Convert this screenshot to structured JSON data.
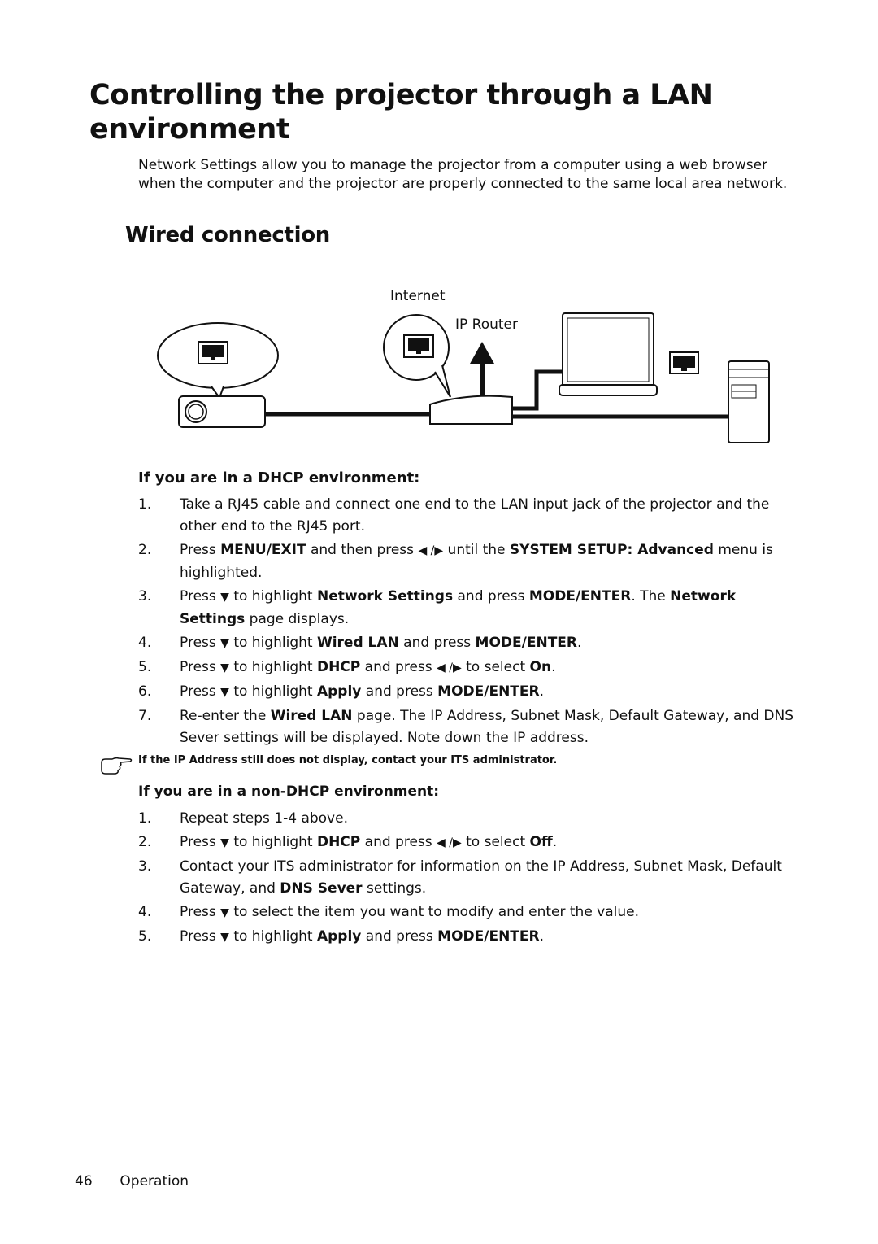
{
  "page": {
    "title": "Controlling the projector through a LAN environment",
    "intro": "Network Settings allow you to manage the projector from a computer using a web browser when the computer and the projector are properly connected to the same local area network.",
    "section_heading": "Wired connection"
  },
  "diagram": {
    "label_internet": "Internet",
    "label_router": "IP Router",
    "components": [
      "projector",
      "ip-router",
      "laptop",
      "desktop-pc",
      "rj45-port-projector",
      "rj45-port-router",
      "rj45-port-computer"
    ]
  },
  "dhcp": {
    "heading": "If you are in a DHCP environment:",
    "steps": [
      {
        "num": "1.",
        "parts": [
          [
            "t",
            "Take a RJ45 cable and connect one end to the LAN input jack of the projector and the other end to the RJ45 port."
          ]
        ]
      },
      {
        "num": "2.",
        "parts": [
          [
            "t",
            "Press "
          ],
          [
            "b",
            "MENU/EXIT"
          ],
          [
            "t",
            " and then press "
          ],
          [
            "a",
            "◀ /▶"
          ],
          [
            "t",
            " until the "
          ],
          [
            "b",
            "SYSTEM SETUP: Advanced"
          ],
          [
            "t",
            " menu is highlighted."
          ]
        ]
      },
      {
        "num": "3.",
        "parts": [
          [
            "t",
            "Press "
          ],
          [
            "a",
            "▼"
          ],
          [
            "t",
            " to highlight "
          ],
          [
            "b",
            "Network Settings"
          ],
          [
            "t",
            " and press "
          ],
          [
            "b",
            "MODE/ENTER"
          ],
          [
            "t",
            ". The "
          ],
          [
            "b",
            "Network Settings"
          ],
          [
            "t",
            " page displays."
          ]
        ]
      },
      {
        "num": "4.",
        "parts": [
          [
            "t",
            "Press "
          ],
          [
            "a",
            "▼"
          ],
          [
            "t",
            " to highlight "
          ],
          [
            "b",
            "Wired LAN"
          ],
          [
            "t",
            " and press "
          ],
          [
            "b",
            "MODE/ENTER"
          ],
          [
            "t",
            "."
          ]
        ]
      },
      {
        "num": "5.",
        "parts": [
          [
            "t",
            "Press "
          ],
          [
            "a",
            "▼"
          ],
          [
            "t",
            " to highlight "
          ],
          [
            "b",
            "DHCP"
          ],
          [
            "t",
            " and press "
          ],
          [
            "a",
            "◀ /▶"
          ],
          [
            "t",
            " to select "
          ],
          [
            "b",
            "On"
          ],
          [
            "t",
            "."
          ]
        ]
      },
      {
        "num": "6.",
        "parts": [
          [
            "t",
            "Press "
          ],
          [
            "a",
            "▼"
          ],
          [
            "t",
            " to highlight "
          ],
          [
            "b",
            "Apply"
          ],
          [
            "t",
            " and press "
          ],
          [
            "b",
            "MODE/ENTER"
          ],
          [
            "t",
            "."
          ]
        ]
      },
      {
        "num": "7.",
        "parts": [
          [
            "t",
            "Re-enter the "
          ],
          [
            "b",
            "Wired LAN"
          ],
          [
            "t",
            " page. The IP Address, Subnet Mask, Default Gateway, and DNS Sever settings will be displayed. Note down the IP address."
          ]
        ]
      }
    ]
  },
  "note": {
    "icon": "pointing-hand-icon",
    "text": "If the IP Address still does not display, contact your ITS administrator."
  },
  "non_dhcp": {
    "heading": "If you are in a non-DHCP environment:",
    "steps": [
      {
        "num": "1.",
        "parts": [
          [
            "t",
            "Repeat steps 1-4 above."
          ]
        ]
      },
      {
        "num": "2.",
        "parts": [
          [
            "t",
            "Press "
          ],
          [
            "a",
            "▼"
          ],
          [
            "t",
            " to highlight "
          ],
          [
            "b",
            "DHCP"
          ],
          [
            "t",
            " and press "
          ],
          [
            "a",
            "◀ /▶"
          ],
          [
            "t",
            " to select "
          ],
          [
            "b",
            "Off"
          ],
          [
            "t",
            "."
          ]
        ]
      },
      {
        "num": "3.",
        "parts": [
          [
            "t",
            "Contact your ITS administrator for information on the IP Address, Subnet Mask, Default Gateway, and "
          ],
          [
            "b",
            "DNS Sever"
          ],
          [
            "t",
            " settings."
          ]
        ]
      },
      {
        "num": "4.",
        "parts": [
          [
            "t",
            "Press "
          ],
          [
            "a",
            "▼"
          ],
          [
            "t",
            " to select the item you want to modify and enter the value."
          ]
        ]
      },
      {
        "num": "5.",
        "parts": [
          [
            "t",
            "Press "
          ],
          [
            "a",
            "▼"
          ],
          [
            "t",
            " to highlight "
          ],
          [
            "b",
            "Apply"
          ],
          [
            "t",
            " and press "
          ],
          [
            "b",
            "MODE/ENTER"
          ],
          [
            "t",
            "."
          ]
        ]
      }
    ]
  },
  "footer": {
    "page_number": "46",
    "section": "Operation"
  }
}
